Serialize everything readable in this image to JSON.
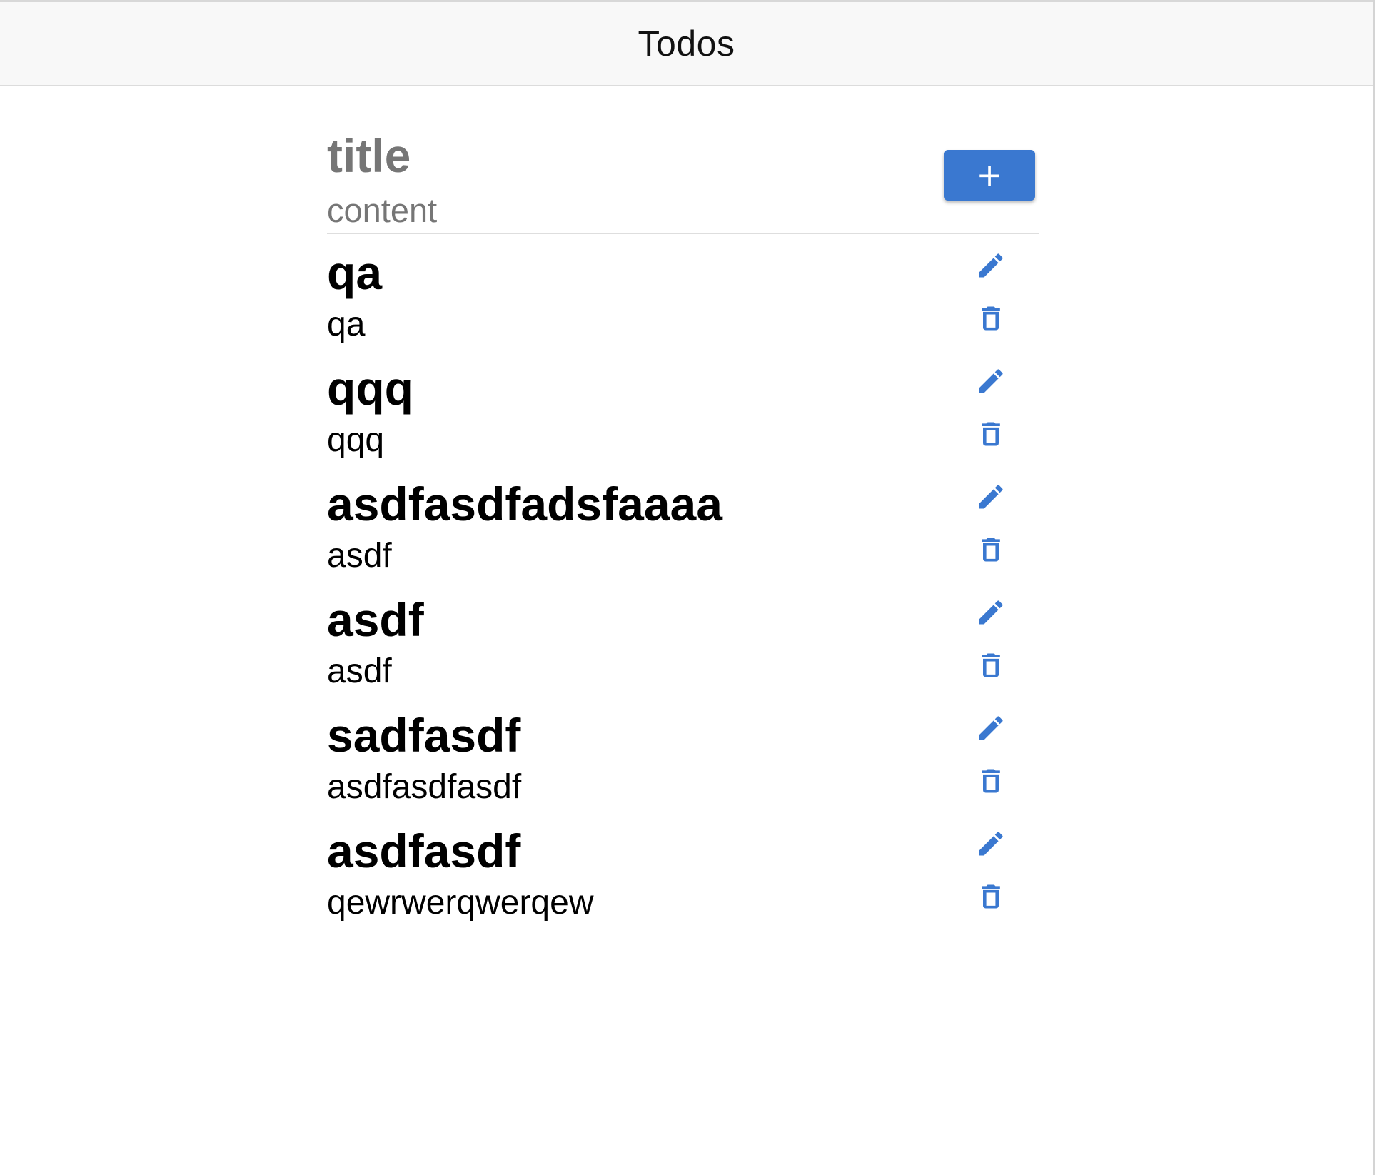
{
  "header": {
    "title": "Todos"
  },
  "composer": {
    "title_placeholder": "title",
    "content_placeholder": "content",
    "title_value": "",
    "content_value": "",
    "add_label": "+"
  },
  "theme": {
    "accent": "#3a78d0",
    "header_bg": "#f8f8f8",
    "placeholder": "#767676"
  },
  "icons": {
    "edit": "pencil-icon",
    "delete": "trash-icon",
    "add": "plus-icon"
  },
  "todos": [
    {
      "title": "qa",
      "content": "qa"
    },
    {
      "title": "qqq",
      "content": "qqq"
    },
    {
      "title": "asdfasdfadsfaaaa",
      "content": "asdf"
    },
    {
      "title": "asdf",
      "content": "asdf"
    },
    {
      "title": "sadfasdf",
      "content": "asdfasdfasdf"
    },
    {
      "title": "asdfasdf",
      "content": "qewrwerqwerqew"
    }
  ]
}
